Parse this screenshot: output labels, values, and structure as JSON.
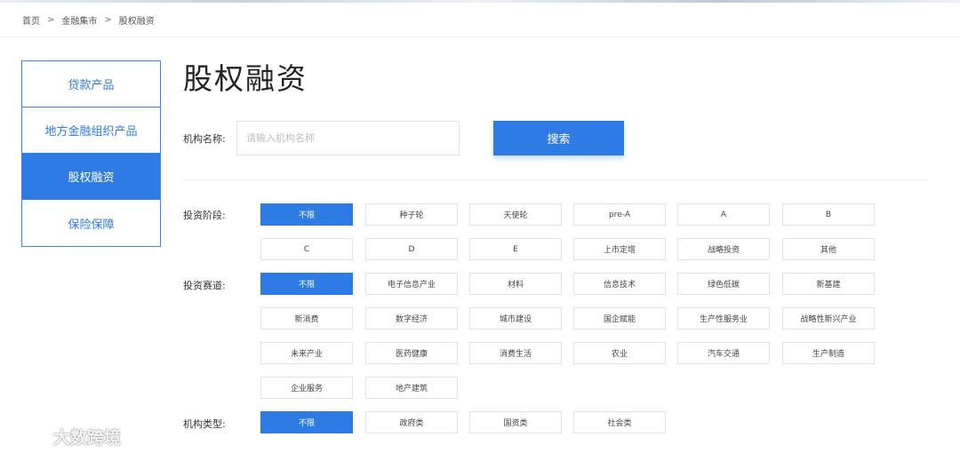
{
  "breadcrumb": [
    "首页",
    "金融集市",
    "股权融资"
  ],
  "breadcrumb_separator": ">",
  "sidebar": {
    "items": [
      {
        "label": "贷款产品",
        "active": false
      },
      {
        "label": "地方金融组织产品",
        "active": false
      },
      {
        "label": "股权融资",
        "active": true
      },
      {
        "label": "保险保障",
        "active": false
      }
    ]
  },
  "page_title": "股权融资",
  "search": {
    "label": "机构名称:",
    "placeholder": "请输入机构名称",
    "value": "",
    "button_label": "搜索"
  },
  "filters": [
    {
      "label": "投资阶段:",
      "options": [
        "不限",
        "种子轮",
        "天使轮",
        "pre-A",
        "A",
        "B",
        "C",
        "D",
        "E",
        "上市定增",
        "战略投资",
        "其他"
      ],
      "selected": "不限"
    },
    {
      "label": "投资赛道:",
      "options": [
        "不限",
        "电子信息产业",
        "材料",
        "信息技术",
        "绿色低碳",
        "新基建",
        "新消费",
        "数字经济",
        "城市建设",
        "国企赋能",
        "生产性服务业",
        "战略性新兴产业",
        "未来产业",
        "医药健康",
        "消费生活",
        "农业",
        "汽车交通",
        "生产制造",
        "企业服务",
        "地产建筑"
      ],
      "selected": "不限"
    },
    {
      "label": "机构类型:",
      "options": [
        "不限",
        "政府类",
        "国资类",
        "社会类"
      ],
      "selected": "不限"
    }
  ],
  "watermark": "大数跨境",
  "colors": {
    "accent": "#2f7be5",
    "border": "#e3e3e3"
  }
}
